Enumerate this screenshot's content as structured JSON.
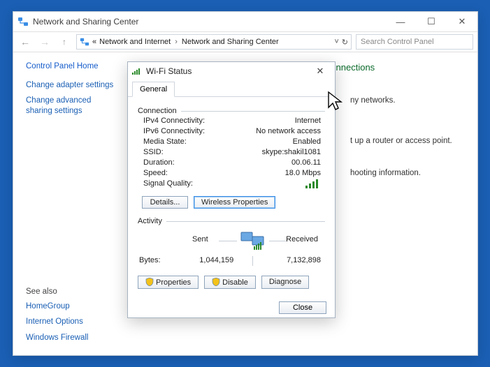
{
  "window": {
    "title": "Network and Sharing Center",
    "controls": {
      "min": "—",
      "max": "☐",
      "close": "✕"
    }
  },
  "addressbar": {
    "root": "Network and Internet",
    "current": "Network and Sharing Center",
    "search_placeholder": "Search Control Panel"
  },
  "leftnav": {
    "home": "Control Panel Home",
    "links": [
      "Change adapter settings",
      "Change advanced sharing settings"
    ],
    "see_also_label": "See also",
    "see_also": [
      "HomeGroup",
      "Internet Options",
      "Windows Firewall"
    ]
  },
  "main": {
    "heading": "View your basic network information and set up connections",
    "hint1": "ny networks.",
    "hint2": "t up a router or access point.",
    "hint3": "hooting information."
  },
  "modal": {
    "title": "Wi-Fi Status",
    "tab": "General",
    "group_connection": "Connection",
    "group_activity": "Activity",
    "rows": {
      "ipv4_k": "IPv4 Connectivity:",
      "ipv4_v": "Internet",
      "ipv6_k": "IPv6 Connectivity:",
      "ipv6_v": "No network access",
      "media_k": "Media State:",
      "media_v": "Enabled",
      "ssid_k": "SSID:",
      "ssid_v": "skype:shakil1081",
      "dur_k": "Duration:",
      "dur_v": "00.06.11",
      "speed_k": "Speed:",
      "speed_v": "18.0 Mbps",
      "sq_k": "Signal Quality:"
    },
    "buttons": {
      "details": "Details...",
      "wireless_props": "Wireless Properties",
      "properties": "Properties",
      "disable": "Disable",
      "diagnose": "Diagnose",
      "close": "Close"
    },
    "activity": {
      "sent_label": "Sent",
      "received_label": "Received",
      "bytes_label": "Bytes:",
      "sent": "1,044,159",
      "received": "7,132,898"
    }
  }
}
